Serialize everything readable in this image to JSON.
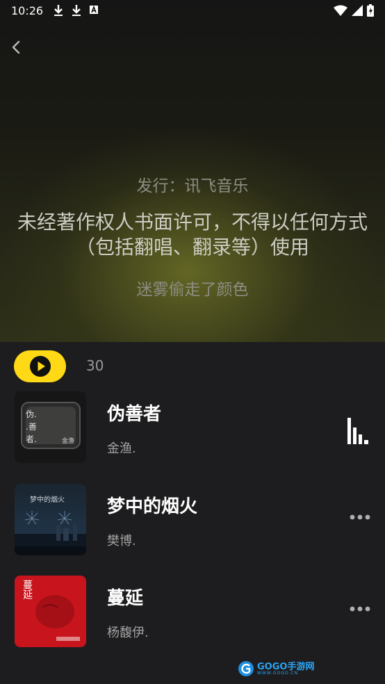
{
  "status_bar": {
    "time": "10:26"
  },
  "lyrics": {
    "publisher": "发行：讯飞音乐",
    "notice": "未经著作权人书面许可，不得以任何方式（包括翻唱、翻录等）使用",
    "current_line": "迷雾偷走了颜色"
  },
  "playlist": {
    "count": "30",
    "songs": [
      {
        "title": "伪善者",
        "artist": "金渔.",
        "cover_text": "伪.\n.善\n者.",
        "cover_sig": "金渔"
      },
      {
        "title": "梦中的烟火",
        "artist": "樊博.",
        "cover_text": "梦中的烟火"
      },
      {
        "title": "蔓延",
        "artist": "杨馥伊.",
        "cover_text": "蔓延"
      }
    ]
  },
  "watermark": {
    "brand": "GOGO手游网",
    "url": "WWW.GOGO.CN"
  },
  "colors": {
    "accent": "#ffd816",
    "panel": "#1d1d1f"
  }
}
